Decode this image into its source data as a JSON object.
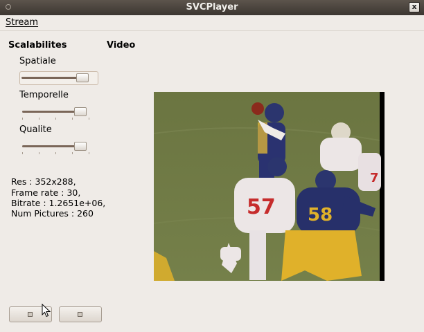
{
  "window": {
    "title": "SVCPlayer",
    "close_glyph": "x"
  },
  "menu": {
    "stream": "Stream"
  },
  "panels": {
    "left_title": "Scalabilites",
    "right_title": "Video"
  },
  "sliders": [
    {
      "label": "Spatiale",
      "level": 0.88
    },
    {
      "label": "Temporelle",
      "level": 0.88
    },
    {
      "label": "Qualite",
      "level": 0.88
    }
  ],
  "stats": {
    "res": "Res : 352x288,",
    "frame_rate": "Frame rate : 30,",
    "bitrate": "Bitrate : 1.2651e+06,",
    "num_pictures": "Num Pictures : 260"
  },
  "video": {
    "jersey_numbers": [
      "57",
      "58"
    ]
  },
  "colors": {
    "field": "#6f7a40",
    "jersey_navy": "#27306a",
    "gold": "#e0b12a",
    "white_jersey": "#ece6e6"
  },
  "icons": [
    "menu-dot-icon",
    "close-icon",
    "pause-icon",
    "stop-icon",
    "cursor-icon"
  ]
}
